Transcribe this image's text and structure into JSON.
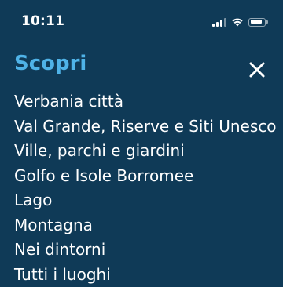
{
  "status_bar": {
    "time": "10:11",
    "icons": [
      "signal-icon",
      "wifi-icon",
      "battery-icon"
    ]
  },
  "header": {
    "title": "Scopri",
    "close_icon": "close-icon"
  },
  "menu": {
    "items": [
      {
        "label": "Verbania città"
      },
      {
        "label": "Val Grande, Riserve e Siti Unesco"
      },
      {
        "label": "Ville, parchi e giardini"
      },
      {
        "label": "Golfo e Isole Borromee"
      },
      {
        "label": "Lago"
      },
      {
        "label": "Montagna"
      },
      {
        "label": "Nei dintorni"
      },
      {
        "label": "Tutti i luoghi"
      }
    ]
  },
  "colors": {
    "background": "#0f3a57",
    "accent": "#4fb3e8",
    "text": "#ffffff"
  }
}
